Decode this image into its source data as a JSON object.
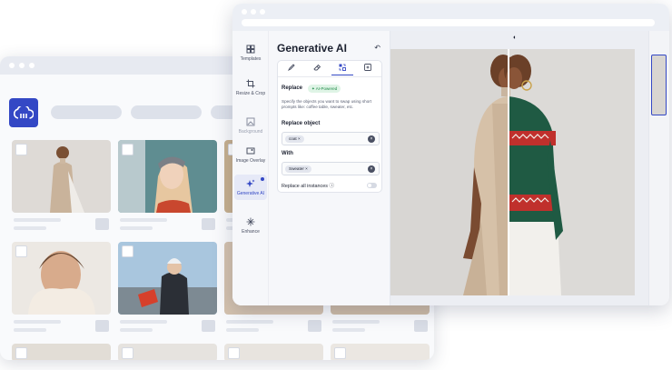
{
  "editor": {
    "panel_title": "Generative AI",
    "tools": [
      {
        "label": "Templates",
        "icon": "templates-icon"
      },
      {
        "label": "Resize & Crop",
        "icon": "crop-icon"
      },
      {
        "label": "Background",
        "icon": "background-icon"
      },
      {
        "label": "Image Overlay",
        "icon": "overlay-icon"
      },
      {
        "label": "Generative AI",
        "icon": "sparkle-icon",
        "active": true
      },
      {
        "label": "Enhance",
        "icon": "enhance-icon"
      }
    ],
    "tabs": [
      "pencil-icon",
      "eraser-icon",
      "replace-icon",
      "add-image-icon"
    ],
    "replace": {
      "title": "Replace",
      "badge": "AI-Powered",
      "description": "Specify the objects you want to swap using short prompts like: coffee table, sweater, etc.",
      "object_label": "Replace object",
      "object_value": "coat",
      "with_label": "With",
      "with_value": "Sweater",
      "toggle_label": "Replace all instances",
      "toggle_on": false
    }
  },
  "colors": {
    "accent": "#3448c5",
    "ai_badge_bg": "#dff4e6",
    "ai_badge_text": "#1f8a47"
  }
}
